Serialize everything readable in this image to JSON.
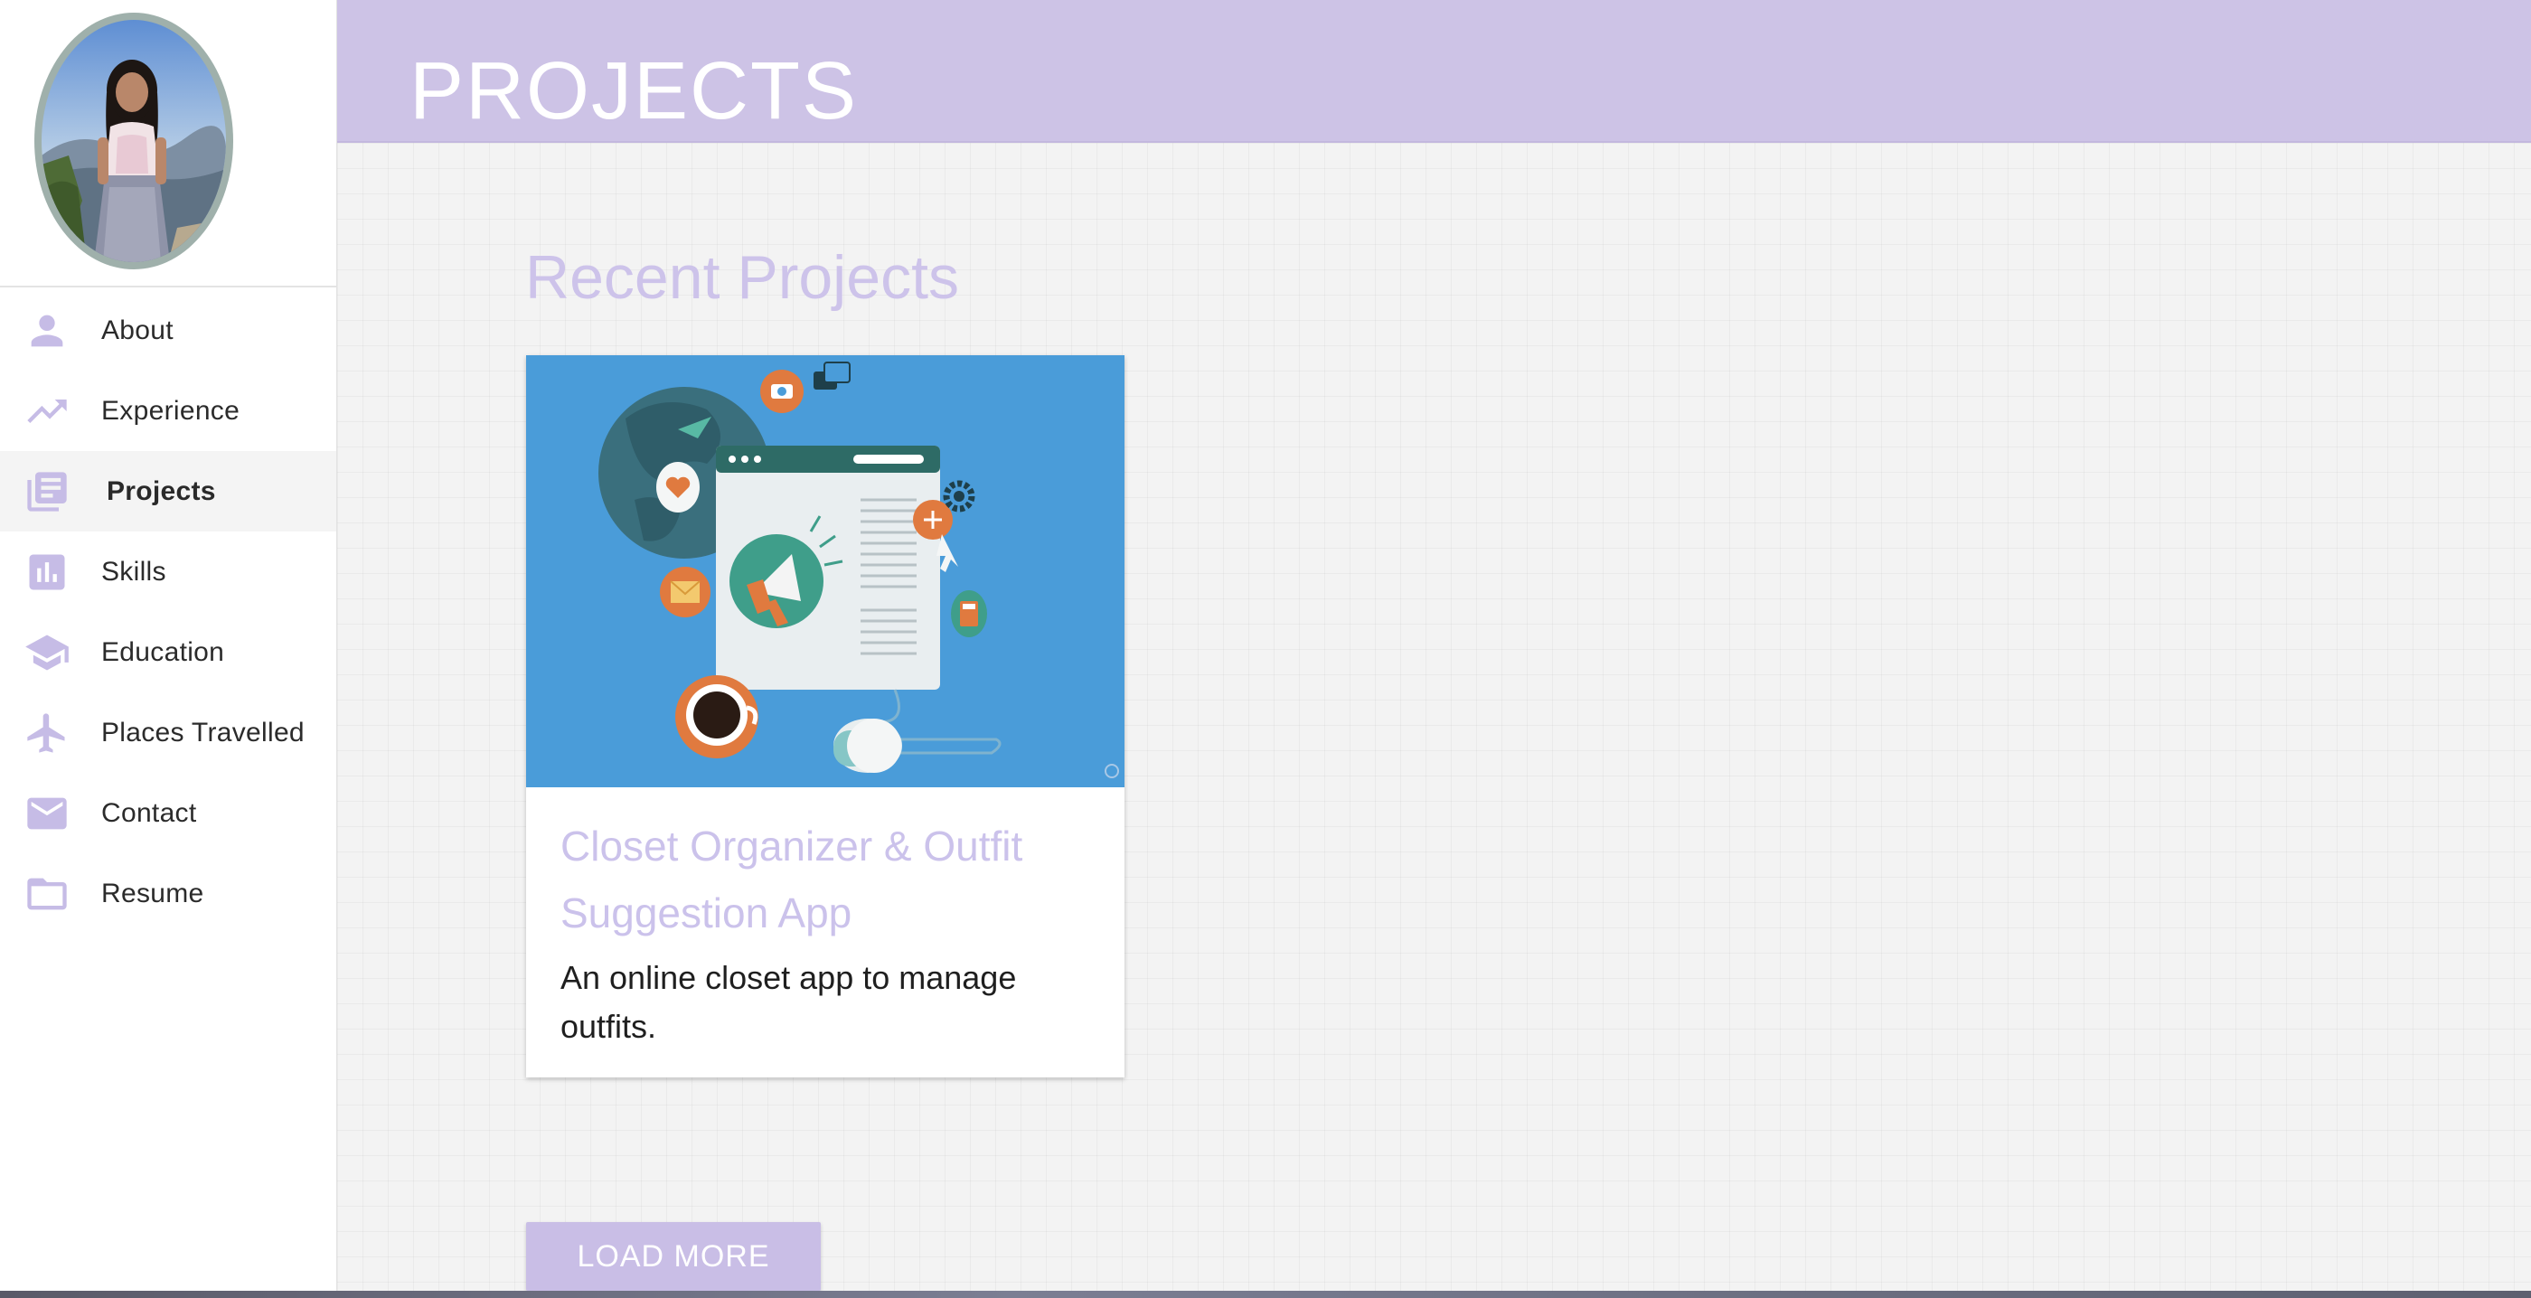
{
  "sidebar": {
    "items": [
      {
        "label": "About",
        "icon": "person-icon"
      },
      {
        "label": "Experience",
        "icon": "trending-up-icon"
      },
      {
        "label": "Projects",
        "icon": "library-books-icon",
        "active": true
      },
      {
        "label": "Skills",
        "icon": "bar-chart-icon"
      },
      {
        "label": "Education",
        "icon": "graduation-cap-icon"
      },
      {
        "label": "Places Travelled",
        "icon": "airplane-icon"
      },
      {
        "label": "Contact",
        "icon": "mail-icon"
      },
      {
        "label": "Resume",
        "icon": "folder-icon"
      }
    ]
  },
  "header": {
    "title": "PROJECTS"
  },
  "main": {
    "section_title": "Recent Projects",
    "card": {
      "title": "Closet Organizer & Outfit Suggestion App",
      "description": "An online closet app to manage outfits."
    },
    "load_more_label": "LOAD MORE"
  },
  "colors": {
    "accent": "#cdc3e6",
    "icon": "#c6bce6",
    "card_image_bg": "#4a9cd9"
  }
}
